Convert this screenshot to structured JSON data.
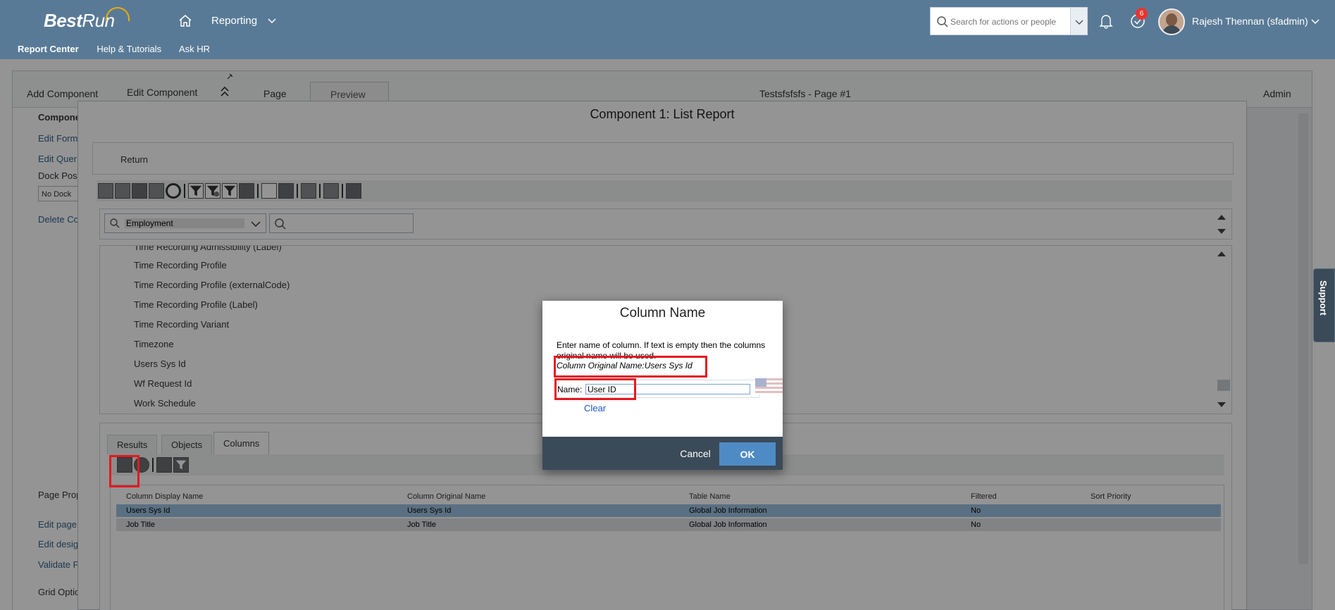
{
  "shell": {
    "logo_bold": "Best",
    "logo_italic": "Run",
    "nav_menu": "Reporting",
    "search_placeholder": "Search for actions or people",
    "notification_count": "6",
    "user_name": "Rajesh Thennan (sfadmin)",
    "subnav": [
      "Report Center",
      "Help & Tutorials",
      "Ask HR"
    ]
  },
  "builder": {
    "top": {
      "add_component": "Add Component",
      "edit_component": "Edit Component",
      "page": "Page",
      "preview": "Preview",
      "page_title": "Testsfsfsfs - Page #1",
      "admin": "Admin"
    },
    "left": {
      "component_heading": "Compone",
      "edit_format": "Edit Form",
      "edit_query": "Edit Quer",
      "dock_position": "Dock Pos",
      "no_dock": "No Dock",
      "delete_component": "Delete Co",
      "page_properties": "Page Prop",
      "edit_page": "Edit page",
      "edit_design": "Edit desig",
      "validate": "Validate P",
      "grid_options": "Grid Optio"
    }
  },
  "component": {
    "title": "Component 1: List Report",
    "return_label": "Return",
    "object_select": "Employment",
    "fields": [
      "Time Recording Admissibility (Label)",
      "Time Recording Profile",
      "Time Recording Profile (externalCode)",
      "Time Recording Profile (Label)",
      "Time Recording Variant",
      "Timezone",
      "Users Sys Id",
      "Wf Request Id",
      "Work Schedule"
    ],
    "tabs": [
      "Results",
      "Objects",
      "Columns"
    ],
    "active_tab": "Columns",
    "grid": {
      "headers": [
        "Column Display Name",
        "Column Original Name",
        "Table Name",
        "Filtered",
        "Sort Priority"
      ],
      "rows": [
        [
          "Users Sys Id",
          "Users Sys Id",
          "Global Job Information",
          "No",
          ""
        ],
        [
          "Job Title",
          "Job Title",
          "Global Job Information",
          "No",
          ""
        ]
      ]
    }
  },
  "dialog": {
    "title": "Column Name",
    "message": "Enter name of column. If text is empty then the columns original name will be used.",
    "original_name": "Column Original Name:Users Sys Id",
    "name_label": "Name:",
    "name_value": "User ID",
    "clear_label": "Clear",
    "cancel_label": "Cancel",
    "ok_label": "OK"
  },
  "support_label": "Support",
  "colors": {
    "shell": "#597a96",
    "highlight": "#e3191f",
    "ok_button": "#4e8bc5",
    "dialog_footer": "#3b4a58",
    "selected_row": "#9cc2e0"
  }
}
